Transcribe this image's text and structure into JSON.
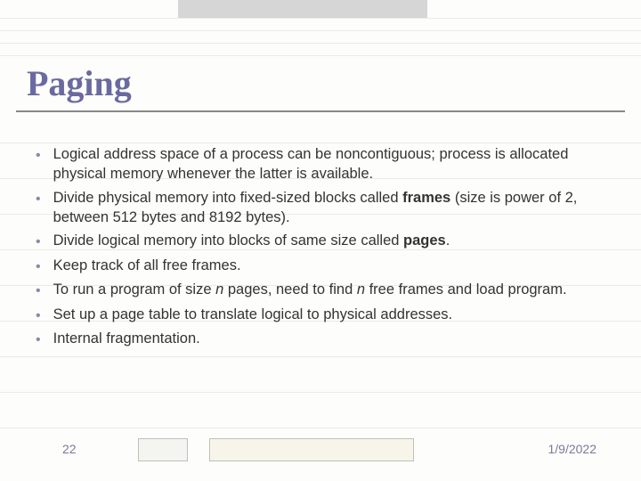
{
  "title": "Paging",
  "bullets": [
    {
      "segments": [
        {
          "t": "Logical address space of a process can be noncontiguous; process is allocated physical memory whenever the latter is available."
        }
      ]
    },
    {
      "segments": [
        {
          "t": "Divide physical memory into fixed-sized blocks called "
        },
        {
          "t": "frames",
          "bold": true
        },
        {
          "t": " (size is power of 2, between 512 bytes and 8192 bytes)."
        }
      ]
    },
    {
      "segments": [
        {
          "t": "Divide logical memory into blocks of same size called "
        },
        {
          "t": "pages",
          "bold": true
        },
        {
          "t": "."
        }
      ]
    },
    {
      "segments": [
        {
          "t": "Keep track of all free frames."
        }
      ]
    },
    {
      "segments": [
        {
          "t": "To run a program of size "
        },
        {
          "t": "n",
          "ital": true
        },
        {
          "t": " pages, need to find "
        },
        {
          "t": "n",
          "ital": true
        },
        {
          "t": " free frames and load program."
        }
      ]
    },
    {
      "segments": [
        {
          "t": "Set up a page table to translate logical to physical addresses."
        }
      ]
    },
    {
      "segments": [
        {
          "t": "Internal fragmentation."
        }
      ]
    }
  ],
  "slide_number": "22",
  "date": "1/9/2022"
}
